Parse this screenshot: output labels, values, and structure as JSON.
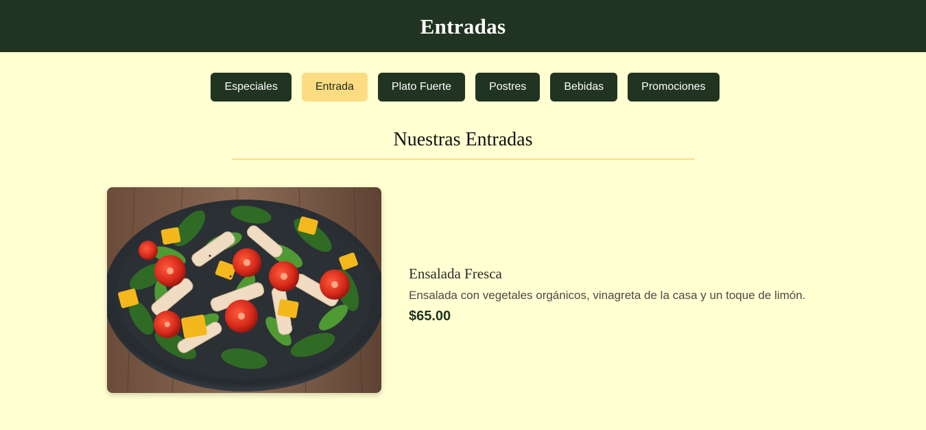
{
  "header": {
    "title": "Entradas"
  },
  "nav": {
    "items": [
      {
        "label": "Especiales",
        "active": false
      },
      {
        "label": "Entrada",
        "active": true
      },
      {
        "label": "Plato Fuerte",
        "active": false
      },
      {
        "label": "Postres",
        "active": false
      },
      {
        "label": "Bebidas",
        "active": false
      },
      {
        "label": "Promociones",
        "active": false
      }
    ]
  },
  "section": {
    "title": "Nuestras Entradas"
  },
  "dish": {
    "name": "Ensalada Fresca",
    "description": "Ensalada con vegetales orgánicos, vinagreta de la casa y un toque de limón.",
    "price": "$65.00",
    "image_icon": "salad-photo"
  },
  "colors": {
    "header_bg": "#213421",
    "page_bg": "#ffffd1",
    "active_tab": "#fcdc82",
    "rule": "#f3e08e"
  }
}
